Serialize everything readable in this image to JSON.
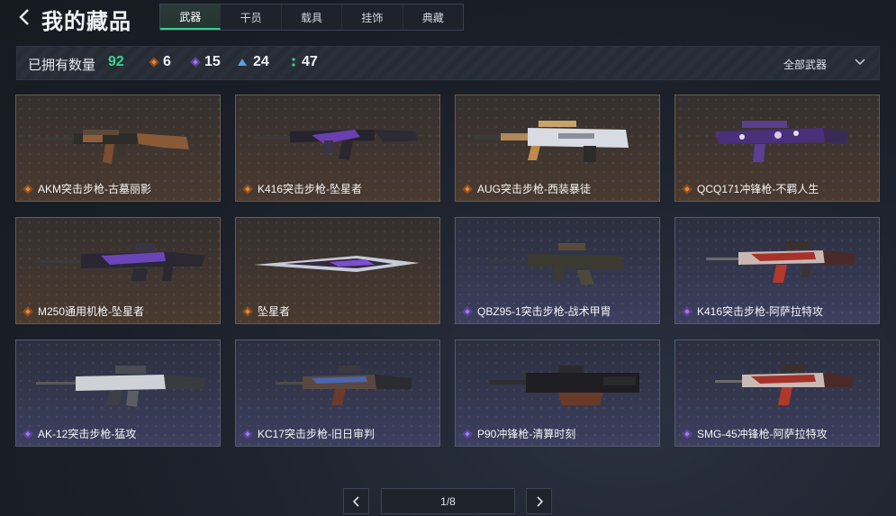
{
  "header": {
    "title": "我的藏品",
    "tabs": [
      {
        "label": "武器",
        "active": true
      },
      {
        "label": "干员",
        "active": false
      },
      {
        "label": "载具",
        "active": false
      },
      {
        "label": "挂饰",
        "active": false
      },
      {
        "label": "典藏",
        "active": false
      }
    ]
  },
  "summary": {
    "owned_label": "已拥有数量",
    "owned_count": "92",
    "rarity_counts": [
      {
        "value": "6",
        "color": "#e28a3a"
      },
      {
        "value": "15",
        "color": "#9a7be0"
      },
      {
        "value": "24",
        "color": "#5aa0e0"
      },
      {
        "value": "47",
        "color": "#39d58e"
      }
    ],
    "filter_label": "全部武器"
  },
  "items": [
    {
      "name": "AKM突击步枪-古墓丽影",
      "rarity": "orange",
      "icon": "rifle-icon"
    },
    {
      "name": "K416突击步枪-坠星者",
      "rarity": "orange",
      "icon": "rifle-icon"
    },
    {
      "name": "AUG突击步枪-西装暴徒",
      "rarity": "orange",
      "icon": "rifle-icon"
    },
    {
      "name": "QCQ171冲锋枪-不羁人生",
      "rarity": "orange",
      "icon": "smg-icon"
    },
    {
      "name": "M250通用机枪-坠星者",
      "rarity": "orange",
      "icon": "machine-gun-icon"
    },
    {
      "name": "坠星者",
      "rarity": "orange",
      "icon": "knife-icon"
    },
    {
      "name": "QBZ95-1突击步枪-战术甲胄",
      "rarity": "purple",
      "icon": "rifle-icon"
    },
    {
      "name": "K416突击步枪-阿萨拉特攻",
      "rarity": "purple",
      "icon": "rifle-icon"
    },
    {
      "name": "AK-12突击步枪-猛攻",
      "rarity": "purple",
      "icon": "rifle-icon"
    },
    {
      "name": "KC17突击步枪-旧日审判",
      "rarity": "purple",
      "icon": "rifle-icon"
    },
    {
      "name": "P90冲锋枪-清算时刻",
      "rarity": "purple",
      "icon": "smg-icon"
    },
    {
      "name": "SMG-45冲锋枪-阿萨拉特攻",
      "rarity": "purple",
      "icon": "smg-icon"
    }
  ],
  "pagination": {
    "label": "1/8"
  }
}
